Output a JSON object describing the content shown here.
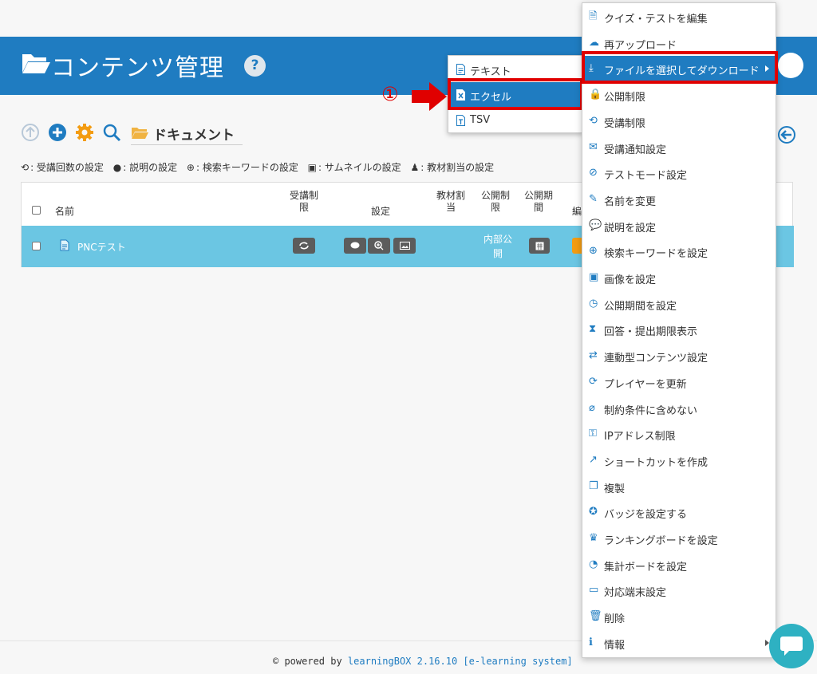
{
  "header": {
    "title": "コンテンツ管理",
    "help": "?"
  },
  "toolbar": {
    "breadcrumb": "ドキュメント"
  },
  "legend": {
    "items": [
      ": 受講回数の設定",
      ": 説明の設定",
      ": 検索キーワードの設定",
      ": サムネイルの設定",
      ": 教材割当の設定"
    ]
  },
  "table": {
    "headers": {
      "name": "名前",
      "attend_limit": "受講制\n限",
      "settings": "設定",
      "assign": "教材割\n当",
      "public_limit": "公開制\n限",
      "public_period": "公開期\n間",
      "edit": "編"
    },
    "rows": [
      {
        "name": "PNCテスト",
        "public": "内部公\n開"
      }
    ]
  },
  "submenu": {
    "items": [
      {
        "label": "テキスト"
      },
      {
        "label": "エクセル"
      },
      {
        "label": "TSV"
      }
    ]
  },
  "annotation": {
    "marker": "①",
    "color": "#e00000"
  },
  "menu": {
    "items": [
      {
        "label": "クイズ・テストを編集",
        "icon": "file-icon"
      },
      {
        "label": "再アップロード",
        "icon": "cloud-upload-icon"
      },
      {
        "label": "ファイルを選択してダウンロード",
        "icon": "download-icon"
      },
      {
        "label": "公開制限",
        "icon": "lock-icon"
      },
      {
        "label": "受講制限",
        "icon": "repeat-icon"
      },
      {
        "label": "受講通知設定",
        "icon": "envelope-icon"
      },
      {
        "label": "テストモード設定",
        "icon": "eye-slash-icon"
      },
      {
        "label": "名前を変更",
        "icon": "pencil-icon"
      },
      {
        "label": "説明を設定",
        "icon": "comment-icon"
      },
      {
        "label": "検索キーワードを設定",
        "icon": "search-plus-icon"
      },
      {
        "label": "画像を設定",
        "icon": "image-icon"
      },
      {
        "label": "公開期間を設定",
        "icon": "clock-icon"
      },
      {
        "label": "回答・提出期限表示",
        "icon": "hourglass-icon"
      },
      {
        "label": "連動型コンテンツ設定",
        "icon": "exchange-icon"
      },
      {
        "label": "プレイヤーを更新",
        "icon": "refresh-icon"
      },
      {
        "label": "制約条件に含めない",
        "icon": "paperclip-icon"
      },
      {
        "label": "IPアドレス制限",
        "icon": "user-lock-icon"
      },
      {
        "label": "ショートカットを作成",
        "icon": "external-link-icon"
      },
      {
        "label": "複製",
        "icon": "copy-icon"
      },
      {
        "label": "バッジを設定する",
        "icon": "award-icon"
      },
      {
        "label": "ランキングボードを設定",
        "icon": "ranking-icon"
      },
      {
        "label": "集計ボードを設定",
        "icon": "pie-chart-icon"
      },
      {
        "label": "対応端末設定",
        "icon": "devices-icon"
      },
      {
        "label": "削除",
        "icon": "trash-icon"
      },
      {
        "label": "情報",
        "icon": "info-icon"
      }
    ]
  },
  "footer": {
    "prefix": "© powered by ",
    "brand": "learningBOX 2.16.10 [e-learning system]"
  },
  "colors": {
    "primary": "#1f7cc1",
    "row": "#6bc6e3",
    "highlight": "#e00000",
    "gear": "#f39c12"
  }
}
